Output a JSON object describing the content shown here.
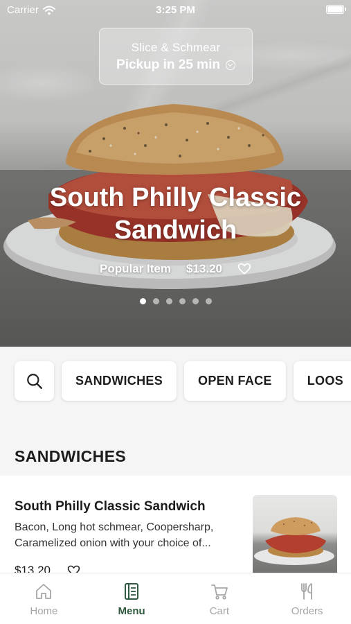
{
  "status_bar": {
    "carrier": "Carrier",
    "time": "3:25 PM"
  },
  "store": {
    "name": "Slice & Schmear",
    "pickup": "Pickup in 25 min"
  },
  "hero": {
    "title": "South Philly Classic Sandwich",
    "tag": "Popular Item",
    "price": "$13.20",
    "slide_count": 6,
    "active_slide": 1
  },
  "categories": {
    "search_icon": "search-icon",
    "items": [
      "SANDWICHES",
      "OPEN FACE",
      "LOOS"
    ]
  },
  "section": {
    "title": "SANDWICHES"
  },
  "menu_item": {
    "name": "South Philly Classic Sandwich",
    "description": "Bacon, Long hot schmear, Coopersharp, Caramelized onion with your choice of...",
    "price": "$13.20"
  },
  "tabbar": {
    "tabs": [
      {
        "label": "Home",
        "icon": "home-icon",
        "active": false
      },
      {
        "label": "Menu",
        "icon": "menu-book-icon",
        "active": true
      },
      {
        "label": "Cart",
        "icon": "cart-icon",
        "active": false
      },
      {
        "label": "Orders",
        "icon": "fork-knife-icon",
        "active": false
      }
    ]
  },
  "colors": {
    "accent": "#2e5a40",
    "inactive": "#a6a6a6",
    "background": "#f5f5f5"
  }
}
